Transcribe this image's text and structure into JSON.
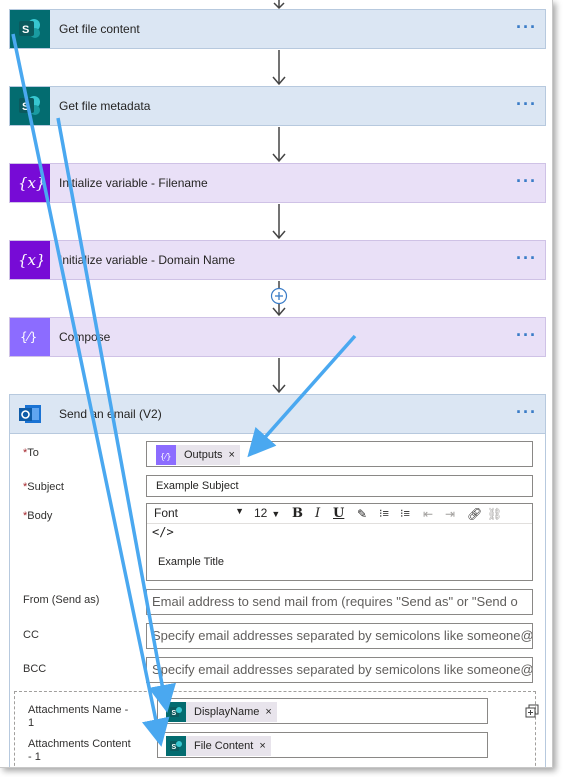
{
  "actions": {
    "get_file_content": {
      "title": "Get file content"
    },
    "get_file_metadata": {
      "title": "Get file metadata"
    },
    "init_filename": {
      "title": "Initialize variable - Filename"
    },
    "init_domain": {
      "title": "Initialize variable - Domain Name"
    },
    "compose": {
      "title": "Compose"
    },
    "send_email": {
      "title": "Send an email (V2)"
    },
    "more_label": "···"
  },
  "email": {
    "to": {
      "label": "To",
      "token": "Outputs"
    },
    "subject": {
      "label": "Subject",
      "value": "Example Subject"
    },
    "body": {
      "label": "Body",
      "font": "Font",
      "size": "12",
      "code_label": "</>",
      "content": "Example Title"
    },
    "from": {
      "label": "From (Send as)",
      "placeholder": "Email address to send mail from (requires \"Send as\" or \"Send o"
    },
    "cc": {
      "label": "CC",
      "placeholder": "Specify email addresses separated by semicolons like someone@"
    },
    "bcc": {
      "label": "BCC",
      "placeholder": "Specify email addresses separated by semicolons like someone@"
    },
    "attachments_name": {
      "label_line1": "Attachments Name -",
      "label_line2": "1",
      "token": "DisplayName"
    },
    "attachments_content": {
      "label_line1": "Attachments Content",
      "label_line2": "- 1",
      "token": "File Content"
    },
    "required_mark": "*",
    "token_remove": "×"
  },
  "colors": {
    "sharepoint": "#036c70",
    "variable": "#770bd6",
    "compose": "#8c6cff",
    "outlook": "#0f6cbd",
    "annotation_arrow": "#4aa8f0"
  }
}
